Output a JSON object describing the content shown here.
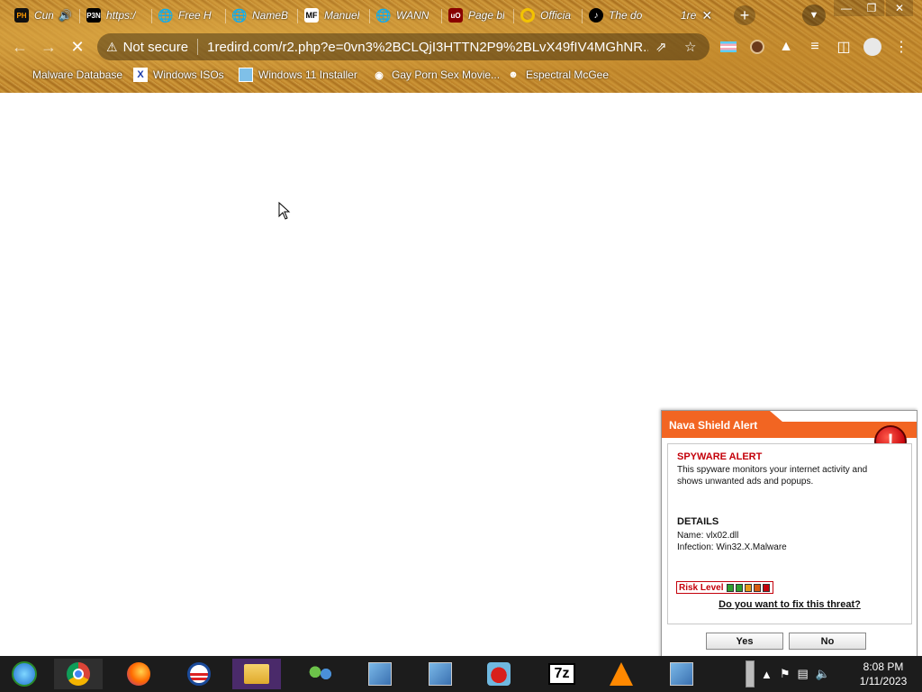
{
  "browser": {
    "tabs": [
      {
        "label": "Cum",
        "favicon": "PH",
        "has_audio": true
      },
      {
        "label": "https:/",
        "favicon": "P3N"
      },
      {
        "label": "Free H",
        "favicon": "globe"
      },
      {
        "label": "NameB",
        "favicon": "globe"
      },
      {
        "label": "Manuel",
        "favicon": "MF"
      },
      {
        "label": "WANN",
        "favicon": "globe"
      },
      {
        "label": "Page bl",
        "favicon": "uBlock"
      },
      {
        "label": "Officia",
        "favicon": "ring"
      },
      {
        "label": "The do",
        "favicon": "tiktok"
      },
      {
        "label": "1re",
        "active": true
      }
    ],
    "new_tab_label": "+",
    "omnibox": {
      "security_label": "Not secure",
      "url": "1redird.com/r2.php?e=0vn3%2BCLQjI3HTTN2P9%2BLvX49fIV4MGhNR..."
    },
    "bookmarks": [
      {
        "label": "Malware Database"
      },
      {
        "label": "Windows ISOs",
        "favicon": "X"
      },
      {
        "label": "Windows 11 Installer"
      },
      {
        "label": "Gay Porn Sex Movie..."
      },
      {
        "label": "Espectral McGee"
      }
    ]
  },
  "alert": {
    "title": "Nava Shield Alert",
    "badge": "!",
    "spyware_title": "SPYWARE ALERT",
    "spyware_text": "This spyware monitors your internet activity and shows unwanted ads and popups.",
    "details_title": "DETAILS",
    "name_line": "Name: vlx02.dll",
    "infection_line": "Infection: Win32.X.Malware",
    "risk_label": "Risk Level",
    "risk_colors": [
      "#2ea02e",
      "#2ea02e",
      "#e69a1a",
      "#d85a10",
      "#c4000a"
    ],
    "question": "Do you want to fix this threat?",
    "yes_label": "Yes",
    "no_label": "No",
    "header_color": "#f26522"
  },
  "taskbar": {
    "apps": [
      "windows-media-center",
      "chrome",
      "firefox",
      "obama-campaign",
      "file-explorer",
      "network-users",
      "installer",
      "installer",
      "angry-birds",
      "7z",
      "vlc",
      "installer"
    ],
    "sevenzip_label": "7z",
    "time": "8:08 PM",
    "date": "1/11/2023"
  }
}
